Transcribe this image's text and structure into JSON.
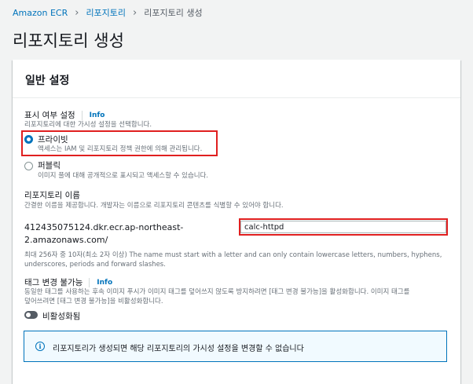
{
  "breadcrumb": {
    "items": [
      "Amazon ECR",
      "리포지토리",
      "리포지토리 생성"
    ],
    "separator": "›"
  },
  "page": {
    "title": "리포지토리 생성"
  },
  "general": {
    "title": "일반 설정",
    "visibility": {
      "label": "표시 여부 설정",
      "info": "Info",
      "description": "리포지토리에 대한 가시성 설정을 선택합니다.",
      "options": [
        {
          "label": "프라이빗",
          "description": "액세스는 IAM 및 리포지토리 정책 권한에 의해 관리됩니다.",
          "selected": true
        },
        {
          "label": "퍼블릭",
          "description": "이미지 풀에 대해 공개적으로 표시되고 액세스할 수 있습니다.",
          "selected": false
        }
      ]
    },
    "repo_name": {
      "label": "리포지토리 이름",
      "description": "간결한 이름을 제공합니다. 개발자는 이름으로 리포지토리 콘텐츠를 식별할 수 있어야 합니다.",
      "uri_line1": "412435075124.dkr.ecr.ap-northeast-",
      "uri_line2": "2.amazonaws.com/",
      "value": "calc-httpd",
      "hint_line1": "최대 256자 중 10자(최소 2자 이상) The name must start with a letter and can only contain lowercase letters, numbers, hyphens,",
      "hint_line2": "underscores, periods and forward slashes."
    },
    "tag_immutability": {
      "label": "태그 변경 불가능",
      "info": "Info",
      "description_line1": "동일한 태그를 사용하는 후속 이미지 푸시가 이미지 태그를 덮어쓰지 않도록 방지하려면 [태그 변경 불가능]을 활성화합니다. 이미지 태그를",
      "description_line2": "덮어쓰려면 [태그 변경 불가능]을 비활성화합니다.",
      "toggle_label": "비활성화됨",
      "enabled": false
    },
    "alert": {
      "icon": "info-icon",
      "text": "리포지토리가 생성되면 해당 리포지토리의 가시성 설정을 변경할 수 없습니다"
    }
  },
  "colors": {
    "link": "#0073bb",
    "highlight": "#e02020",
    "alert_bg": "#f1faff"
  }
}
